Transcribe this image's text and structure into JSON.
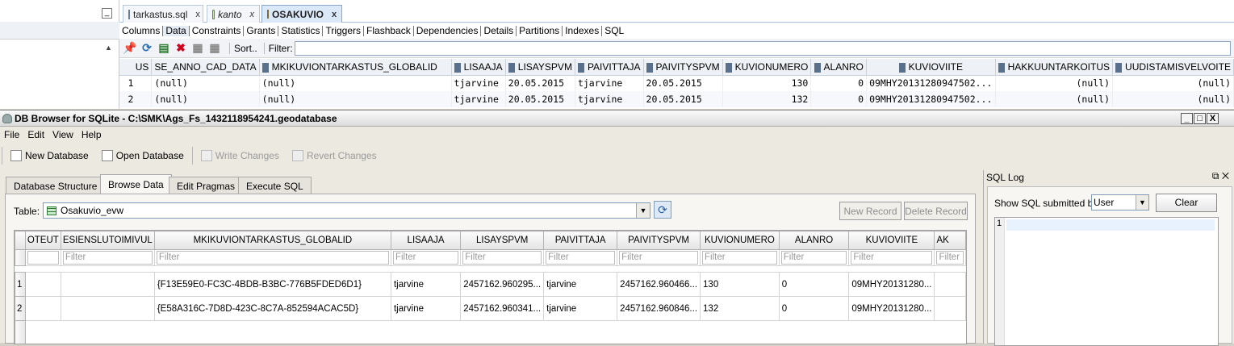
{
  "sqldev": {
    "minimize": "_",
    "tabs": [
      {
        "label": "tarkastus.sql",
        "close": "x"
      },
      {
        "label": "kanto",
        "close": "x"
      },
      {
        "label": "OSAKUVIO",
        "close": "x"
      }
    ],
    "subtabs": [
      "Columns",
      "Data",
      "Constraints",
      "Grants",
      "Statistics",
      "Triggers",
      "Flashback",
      "Dependencies",
      "Details",
      "Partitions",
      "Indexes",
      "SQL"
    ],
    "sort_label": "Sort..",
    "filter_label": "Filter:",
    "columns": [
      "US",
      "SE_ANNO_CAD_DATA",
      "MKIKUVIONTARKASTUS_GLOBALID",
      "LISAAJA",
      "LISAYSPVM",
      "PAIVITTAJA",
      "PAIVITYSPVM",
      "KUVIONUMERO",
      "ALANRO",
      "KUVIOVIITE",
      "HAKKUUNTARKOITUS",
      "UUDISTAMISVELVOITE"
    ],
    "rows": [
      [
        "1",
        "(null)",
        "(null)",
        "tjarvine",
        "20.05.2015",
        "tjarvine",
        "20.05.2015",
        "130",
        "0",
        "09MHY20131280947502...",
        "(null)",
        "(null)"
      ],
      [
        "2",
        "(null)",
        "(null)",
        "tjarvine",
        "20.05.2015",
        "tjarvine",
        "20.05.2015",
        "132",
        "0",
        "09MHY20131280947502...",
        "(null)",
        "(null)"
      ]
    ]
  },
  "dbbrowser": {
    "title": "DB Browser for SQLite - C:\\SMK\\Ags_Fs_1432118954241.geodatabase",
    "window_buttons": [
      "_",
      "□",
      "X"
    ],
    "menu": [
      "File",
      "Edit",
      "View",
      "Help"
    ],
    "toolbar": {
      "new_db": "New Database",
      "open_db": "Open Database",
      "write": "Write Changes",
      "revert": "Revert Changes"
    },
    "tabs": [
      "Database Structure",
      "Browse Data",
      "Edit Pragmas",
      "Execute SQL"
    ],
    "table_label": "Table:",
    "table_value": "Osakuvio_evw",
    "new_record": "New Record",
    "delete_record": "Delete Record",
    "filter_placeholder": "Filter",
    "columns": [
      "OTEUT",
      "ESIENSLUTOIMIVUL",
      "MKIKUVIONTARKASTUS_GLOBALID",
      "LISAAJA",
      "LISAYSPVM",
      "PAIVITTAJA",
      "PAIVITYSPVM",
      "KUVIONUMERO",
      "ALANRO",
      "KUVIOVIITE",
      "AK"
    ],
    "rows": [
      {
        "num": "1",
        "cells": [
          "",
          "",
          "{F13E59E0-FC3C-4BDB-B3BC-776B5FDED6D1}",
          "tjarvine",
          "2457162.960295...",
          "tjarvine",
          "2457162.960466...",
          "130",
          "0",
          "09MHY20131280...",
          ""
        ]
      },
      {
        "num": "2",
        "cells": [
          "",
          "",
          "{E58A316C-7D8D-423C-8C7A-852594ACAC5D}",
          "tjarvine",
          "2457162.960341...",
          "tjarvine",
          "2457162.960846...",
          "132",
          "0",
          "09MHY20131280...",
          ""
        ]
      }
    ]
  },
  "sqllog": {
    "title": "SQL Log",
    "show_label": "Show SQL submitted by",
    "user_value": "User",
    "clear": "Clear",
    "line_number": "1"
  }
}
